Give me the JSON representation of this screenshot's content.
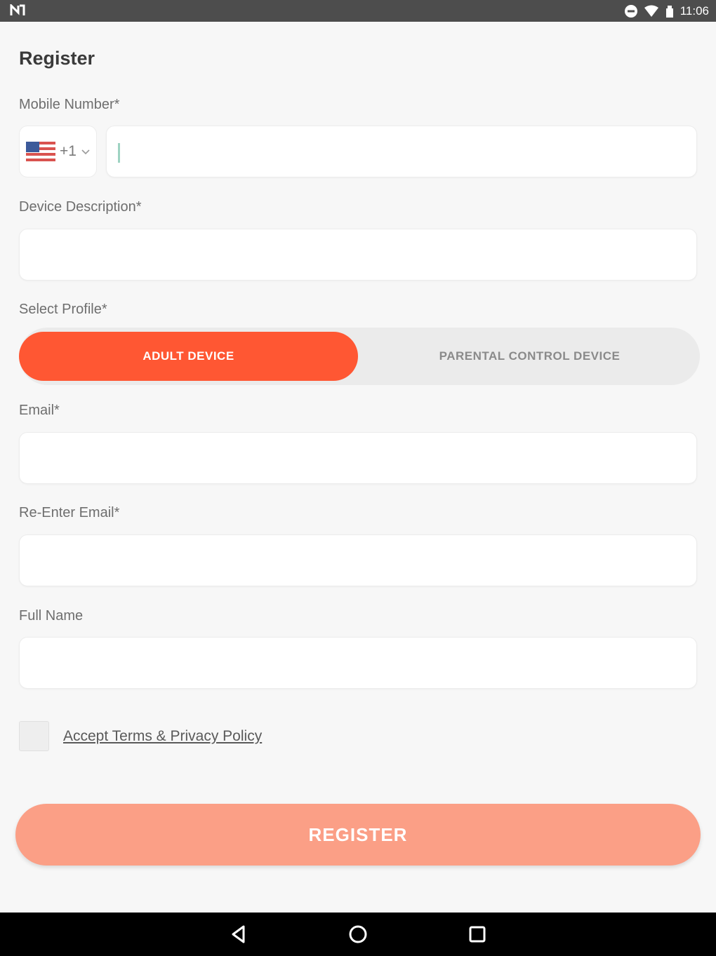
{
  "status_bar": {
    "time": "11:06",
    "icons": [
      "n-logo-icon",
      "dnd-icon",
      "wifi-icon",
      "signal-icon"
    ]
  },
  "form": {
    "title": "Register",
    "mobile": {
      "label": "Mobile Number*",
      "country_flag": "us-flag-icon",
      "country_code": "+1",
      "value": ""
    },
    "device_description": {
      "label": "Device Description*",
      "value": ""
    },
    "profile": {
      "label": "Select Profile*",
      "options": [
        "ADULT DEVICE",
        "PARENTAL CONTROL DEVICE"
      ],
      "selected": "ADULT DEVICE"
    },
    "email": {
      "label": "Email*",
      "value": ""
    },
    "re_email": {
      "label": "Re-Enter Email*",
      "value": ""
    },
    "full_name": {
      "label": "Full Name",
      "value": ""
    },
    "terms": {
      "label": "Accept Terms & Privacy Policy",
      "checked": false
    },
    "submit_label": "REGISTER"
  },
  "nav": [
    "back-icon",
    "home-icon",
    "recents-icon"
  ],
  "colors": {
    "accent": "#ff5733",
    "register_button": "#fb9f86",
    "background": "#f7f7f7",
    "status_bar": "#4d4d4d"
  }
}
